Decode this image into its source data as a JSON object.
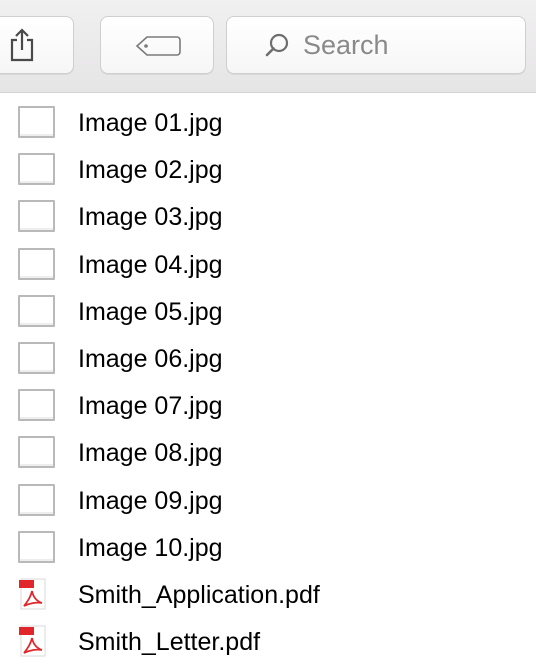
{
  "toolbar": {
    "search_placeholder": "Search"
  },
  "files": [
    {
      "name": "Image 01.jpg",
      "type": "jpg"
    },
    {
      "name": "Image 02.jpg",
      "type": "jpg"
    },
    {
      "name": "Image 03.jpg",
      "type": "jpg"
    },
    {
      "name": "Image 04.jpg",
      "type": "jpg"
    },
    {
      "name": "Image 05.jpg",
      "type": "jpg"
    },
    {
      "name": "Image 06.jpg",
      "type": "jpg"
    },
    {
      "name": "Image 07.jpg",
      "type": "jpg"
    },
    {
      "name": "Image 08.jpg",
      "type": "jpg"
    },
    {
      "name": "Image 09.jpg",
      "type": "jpg"
    },
    {
      "name": "Image 10.jpg",
      "type": "jpg"
    },
    {
      "name": "Smith_Application.pdf",
      "type": "pdf"
    },
    {
      "name": "Smith_Letter.pdf",
      "type": "pdf"
    }
  ],
  "icons": {
    "share": "share-icon",
    "tag": "tag-icon",
    "search": "search-icon",
    "image_file": "image-file-icon",
    "pdf_file": "pdf-file-icon"
  },
  "colors": {
    "pdf_red": "#e0262b",
    "placeholder_gray": "#8a8a8a"
  }
}
